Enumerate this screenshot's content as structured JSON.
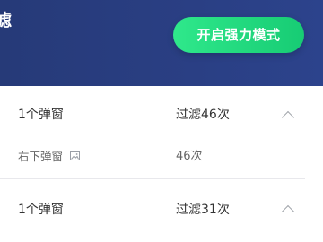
{
  "header": {
    "title": "滤",
    "mode_button_label": "开启强力模式"
  },
  "groups": [
    {
      "count_label": "1个弹窗",
      "filter_label": "过滤46次",
      "expanded": true,
      "details": [
        {
          "label": "右下弹窗",
          "icon": "image-icon",
          "count": "46次"
        }
      ]
    },
    {
      "count_label": "1个弹窗",
      "filter_label": "过滤31次",
      "expanded": true
    }
  ],
  "colors": {
    "header_bg": "#2a3f84",
    "button_green": "#22d97e"
  }
}
